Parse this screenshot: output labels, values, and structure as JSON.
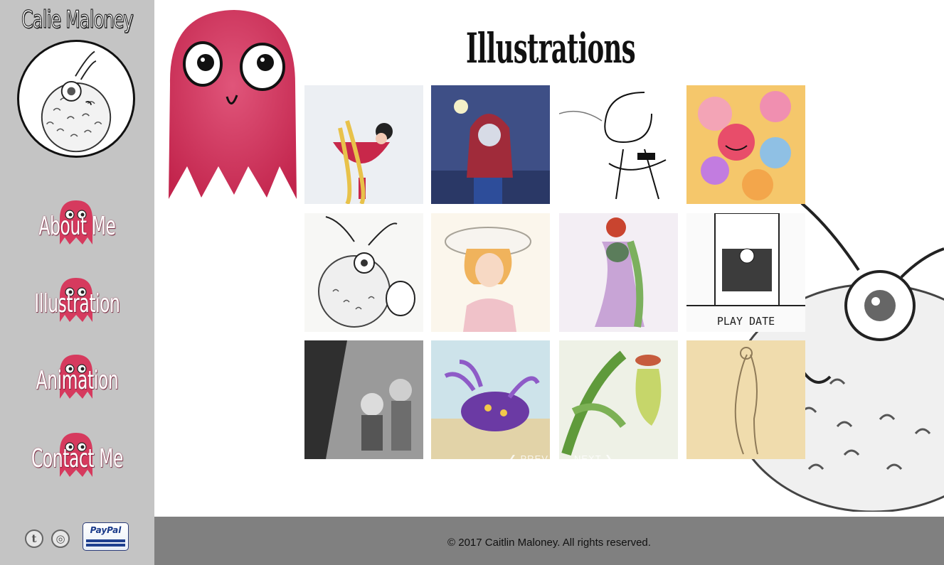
{
  "site": {
    "title": "Calie Maloney"
  },
  "nav": [
    {
      "label": "About Me"
    },
    {
      "label": "Illustration"
    },
    {
      "label": "Animation"
    },
    {
      "label": "Contact Me"
    }
  ],
  "social": {
    "tumblr": "t",
    "instagram": "◎",
    "paypal_label": "PayPal"
  },
  "page": {
    "title": "Illustrations"
  },
  "gallery": {
    "tiles": [
      {
        "subject": "rapunzel-in-cup"
      },
      {
        "subject": "red-hood-with-lantern"
      },
      {
        "subject": "sketch-girl"
      },
      {
        "subject": "colorful-crowd"
      },
      {
        "subject": "furry-creature-sketch"
      },
      {
        "subject": "girl-in-sunhat"
      },
      {
        "subject": "woman-in-purple-dress"
      },
      {
        "subject": "boy-on-throne",
        "caption": "PLAY DATE"
      },
      {
        "subject": "kids-with-monsters"
      },
      {
        "subject": "purple-sea-creature"
      },
      {
        "subject": "pitcher-plant"
      },
      {
        "subject": "figure-drawing"
      }
    ],
    "prev_label": "PREV",
    "next_label": "NEXT"
  },
  "footer": {
    "text": "© 2017 Caitlin Maloney. All rights reserved."
  },
  "colors": {
    "sidebar": "#c4c4c4",
    "footer": "#808080",
    "ghost": "#d63a5e"
  }
}
